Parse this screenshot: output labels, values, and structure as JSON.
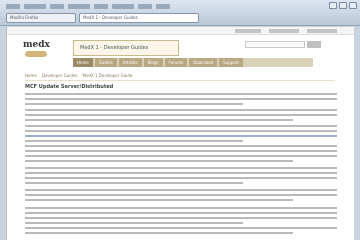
{
  "browser": {
    "tabs": [
      "Mozilla Firefox",
      "MedX 1 - Developer Guides"
    ],
    "menu_count": 8
  },
  "site": {
    "logo_text": "medx",
    "banner_title": "MedX 1 - Developer Guides",
    "nav_tabs": [
      "Home",
      "Guides",
      "Articles",
      "Blogs",
      "Forums",
      "Download",
      "Support"
    ],
    "breadcrumb": [
      "Home",
      "Developer Guides",
      "MedX 1 Developer Guide"
    ],
    "page_heading": "MCF Update Server/Distributed"
  },
  "colors": {
    "accent": "#b8a982",
    "accent_dark": "#9a8a63",
    "link": "#9ab0cf"
  }
}
